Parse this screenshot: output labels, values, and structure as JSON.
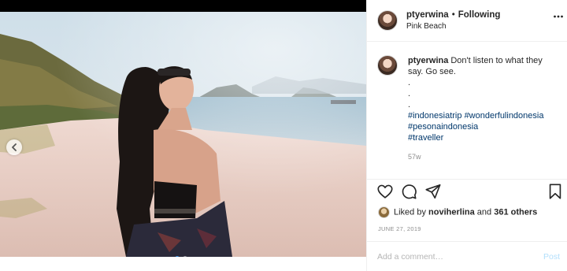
{
  "post": {
    "username": "ptyerwina",
    "separator": "•",
    "follow_state": "Following",
    "location": "Pink Beach",
    "caption": {
      "username": "ptyerwina",
      "lines": [
        "Don't listen to what they",
        "say. Go see.",
        ".",
        ".",
        "."
      ],
      "hashtags": [
        "#indonesiatrip",
        "#wonderfulindonesia",
        "#pesonaindonesia",
        "#traveller"
      ]
    },
    "age": "57w",
    "likes": {
      "prefix": "Liked by",
      "user": "noviherlina",
      "conj": "and",
      "others": "361 others"
    },
    "date": "JUNE 27, 2019"
  },
  "comment": {
    "placeholder": "Add a comment…",
    "post_label": "Post"
  },
  "carousel": {
    "total_slides": 2,
    "active_slide": 1
  },
  "icons": {
    "more": "more-options-icon",
    "like": "heart-icon",
    "comment": "comment-icon",
    "share": "share-icon",
    "save": "bookmark-icon",
    "prev": "chevron-left-icon"
  },
  "colors": {
    "link_blue": "#00376b",
    "post_blue": "#b2dffc",
    "active_dot": "#3897f0",
    "meta_gray": "#8e8e8e"
  }
}
